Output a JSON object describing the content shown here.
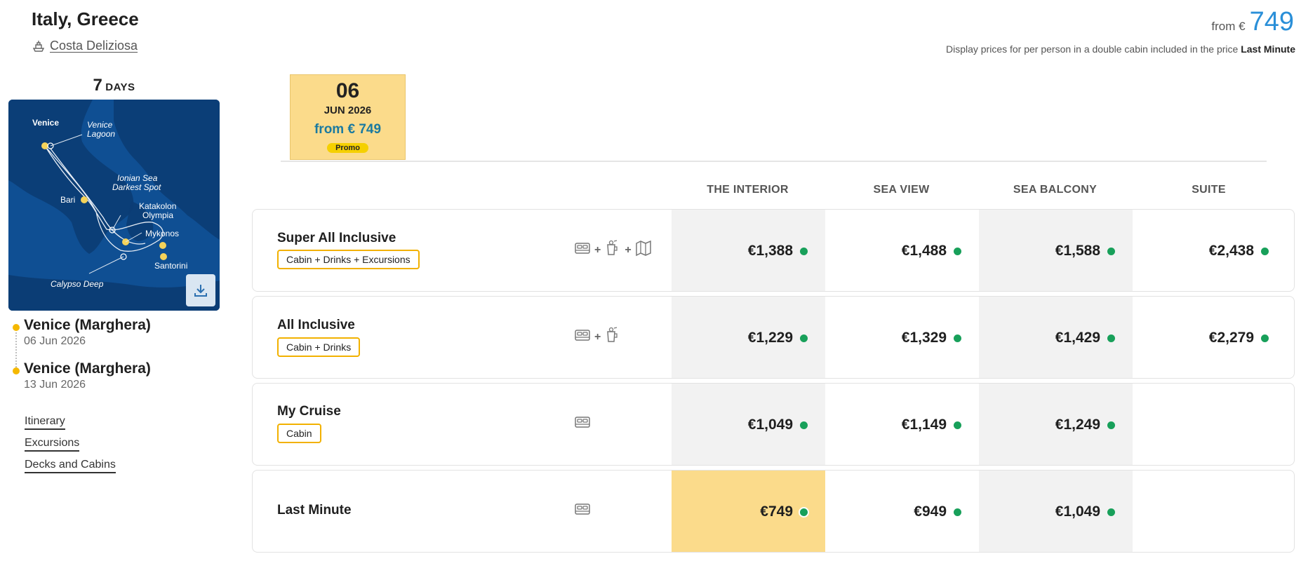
{
  "header": {
    "title": "Italy, Greece",
    "ship": "Costa Deliziosa",
    "from_label": "from €",
    "from_value": "749",
    "disclaimer_text": "Display prices for per person in a double cabin included in the price",
    "disclaimer_bold": "Last Minute"
  },
  "duration": {
    "number": "7",
    "unit": "DAYS"
  },
  "map": {
    "labels": {
      "venice": "Venice",
      "lagoon_1": "Venice",
      "lagoon_2": "Lagoon",
      "ionian_1": "Ionian Sea",
      "ionian_2": "Darkest Spot",
      "bari": "Bari",
      "katakolon": "Katakolon",
      "olympia": "Olympia",
      "mykonos": "Mykonos",
      "santorini": "Santorini",
      "calypso": "Calypso Deep"
    },
    "download_icon": "download-icon"
  },
  "route": [
    {
      "port": "Venice (Marghera)",
      "date": "06 Jun 2026"
    },
    {
      "port": "Venice (Marghera)",
      "date": "13 Jun 2026"
    }
  ],
  "links": [
    "Itinerary",
    "Excursions",
    "Decks and Cabins"
  ],
  "date_card": {
    "day": "06",
    "month": "JUN 2026",
    "from": "from € 749",
    "badge": "Promo"
  },
  "columns": [
    "THE INTERIOR",
    "SEA VIEW",
    "SEA BALCONY",
    "SUITE"
  ],
  "rows": [
    {
      "name": "Super All Inclusive",
      "tag": "Cabin + Drinks + Excursions",
      "icons": [
        "bed-icon",
        "drink-icon",
        "map-icon"
      ],
      "prices": [
        "€1,388",
        "€1,488",
        "€1,588",
        "€2,438"
      ]
    },
    {
      "name": "All Inclusive",
      "tag": "Cabin + Drinks",
      "icons": [
        "bed-icon",
        "drink-icon"
      ],
      "prices": [
        "€1,229",
        "€1,329",
        "€1,429",
        "€2,279"
      ]
    },
    {
      "name": "My Cruise",
      "tag": "Cabin",
      "icons": [
        "bed-icon"
      ],
      "prices": [
        "€1,049",
        "€1,149",
        "€1,249",
        ""
      ]
    },
    {
      "name": "Last Minute",
      "tag": "",
      "icons": [
        "bed-icon"
      ],
      "prices": [
        "€749",
        "€949",
        "€1,049",
        ""
      ]
    }
  ],
  "plus": "+",
  "colors": {
    "accent_blue": "#2a8fd8",
    "highlight_yellow": "#fbdb8b",
    "tag_border": "#f2b100",
    "available_green": "#18a05a"
  }
}
